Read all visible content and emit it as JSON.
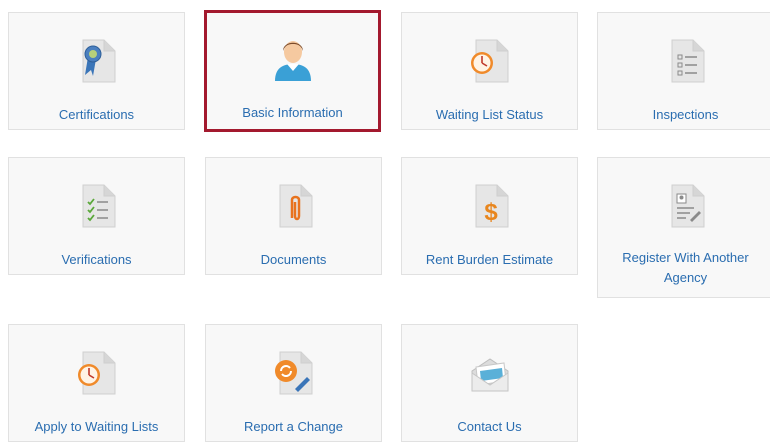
{
  "tiles": [
    {
      "label": "Certifications"
    },
    {
      "label": "Basic Information"
    },
    {
      "label": "Waiting List Status"
    },
    {
      "label": "Inspections"
    },
    {
      "label": "Verifications"
    },
    {
      "label": "Documents"
    },
    {
      "label": "Rent Burden Estimate"
    },
    {
      "label": "Register With Another Agency"
    },
    {
      "label": "Apply to Waiting Lists"
    },
    {
      "label": "Report a Change"
    },
    {
      "label": "Contact Us"
    }
  ],
  "icons": [
    "ribbon-award-icon",
    "user-avatar-icon",
    "clock-document-icon",
    "checklist-icon",
    "checkmark-list-icon",
    "paperclip-icon",
    "dollar-document-icon",
    "profile-edit-icon",
    "clock-document-icon",
    "refresh-edit-icon",
    "envelope-icon"
  ],
  "colors": {
    "link": "#2a6db0",
    "selected_border": "#a3192e",
    "tile_bg": "#f8f8f8",
    "tile_border": "#e1e1e1"
  }
}
